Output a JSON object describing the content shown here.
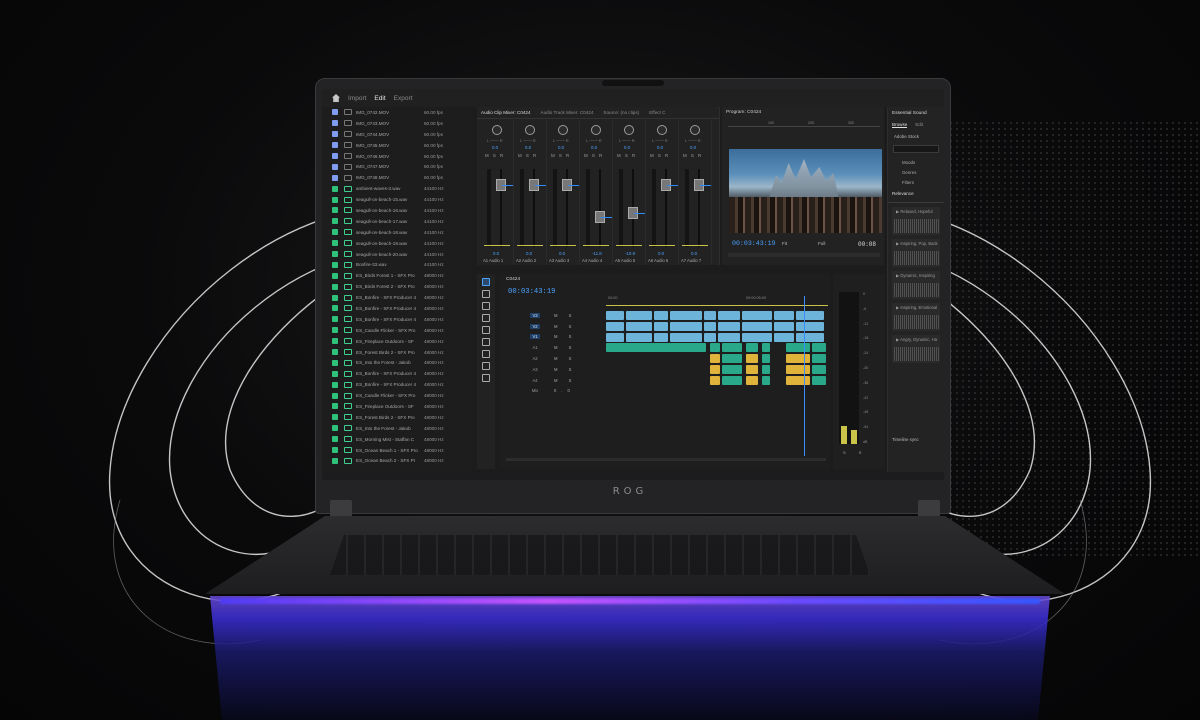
{
  "brand": "ROG",
  "topbar": {
    "items": [
      "Import",
      "Edit",
      "Export"
    ],
    "active": "Edit"
  },
  "project": {
    "rows": [
      {
        "type": "video",
        "name": "IMG_0742.MOV",
        "rate": "60.00 fps"
      },
      {
        "type": "video",
        "name": "IMG_0743.MOV",
        "rate": "60.00 fps"
      },
      {
        "type": "video",
        "name": "IMG_0744.MOV",
        "rate": "60.00 fps"
      },
      {
        "type": "video",
        "name": "IMG_0745.MOV",
        "rate": "60.00 fps"
      },
      {
        "type": "video",
        "name": "IMG_0746.MOV",
        "rate": "60.00 fps"
      },
      {
        "type": "video",
        "name": "IMG_0747.MOV",
        "rate": "60.00 fps"
      },
      {
        "type": "video",
        "name": "IMG_0748.MOV",
        "rate": "60.00 fps"
      },
      {
        "type": "audio",
        "name": "ambient-waves-3.wav",
        "rate": "44100 Hz"
      },
      {
        "type": "audio",
        "name": "seagull-on-beach-15.wav",
        "rate": "44100 Hz"
      },
      {
        "type": "audio",
        "name": "seagull-on-beach-16.wav",
        "rate": "44100 Hz"
      },
      {
        "type": "audio",
        "name": "seagull-on-beach-17.wav",
        "rate": "44100 Hz"
      },
      {
        "type": "audio",
        "name": "seagull-on-beach-18.wav",
        "rate": "44100 Hz"
      },
      {
        "type": "audio",
        "name": "seagull-on-beach-19.wav",
        "rate": "44100 Hz"
      },
      {
        "type": "audio",
        "name": "seagull-on-beach-20.wav",
        "rate": "44100 Hz"
      },
      {
        "type": "audio",
        "name": "Bonfire-33.wav",
        "rate": "44100 Hz"
      },
      {
        "type": "audio",
        "name": "ES_Birds Forest 1 - SFX Pro",
        "rate": "48000 Hz"
      },
      {
        "type": "audio",
        "name": "ES_Birds Forest 2 - SFX Pro",
        "rate": "48000 Hz"
      },
      {
        "type": "audio",
        "name": "ES_Bonfire - SFX Producer 4",
        "rate": "48000 Hz"
      },
      {
        "type": "audio",
        "name": "ES_Bonfire - SFX Producer 4",
        "rate": "48000 Hz"
      },
      {
        "type": "audio",
        "name": "ES_Bonfire - SFX Producer 4",
        "rate": "48000 Hz"
      },
      {
        "type": "audio",
        "name": "ES_Candle Flicker - SFX Pro",
        "rate": "48000 Hz"
      },
      {
        "type": "audio",
        "name": "ES_Fireplace Outdoors - SF",
        "rate": "48000 Hz"
      },
      {
        "type": "audio",
        "name": "ES_Forest Birds 2 - SFX Pro",
        "rate": "48000 Hz"
      },
      {
        "type": "audio",
        "name": "ES_Into the Forest - Jakob",
        "rate": "48000 Hz"
      },
      {
        "type": "audio",
        "name": "ES_Bonfire - SFX Producer 4",
        "rate": "48000 Hz"
      },
      {
        "type": "audio",
        "name": "ES_Bonfire - SFX Producer 4",
        "rate": "48000 Hz"
      },
      {
        "type": "audio",
        "name": "ES_Candle Flicker - SFX Pro",
        "rate": "48000 Hz"
      },
      {
        "type": "audio",
        "name": "ES_Fireplace Outdoors - SF",
        "rate": "48000 Hz"
      },
      {
        "type": "audio",
        "name": "ES_Forest Birds 2 - SFX Pro",
        "rate": "48000 Hz"
      },
      {
        "type": "audio",
        "name": "ES_Into the Forest - Jakob",
        "rate": "48000 Hz"
      },
      {
        "type": "audio",
        "name": "ES_Morning Mist - Staffan C",
        "rate": "48000 Hz"
      },
      {
        "type": "audio",
        "name": "ES_Ocean Beach 1 - SFX Pro",
        "rate": "48000 Hz"
      },
      {
        "type": "audio",
        "name": "ES_Ocean Beach 2 - SFX Pr",
        "rate": "48000 Hz"
      }
    ]
  },
  "mixer": {
    "tabs": [
      "Audio Clip Mixer: C0424",
      "Audio Track Mixer: C0424",
      "Source: (no clips)",
      "Effect C"
    ],
    "channels": [
      {
        "pan": "0.0",
        "db": "0.0",
        "name": "Audio 1",
        "track": "A1"
      },
      {
        "pan": "0.0",
        "db": "0.0",
        "name": "Audio 2",
        "track": "A2"
      },
      {
        "pan": "0.0",
        "db": "0.0",
        "name": "Audio 3",
        "track": "A3"
      },
      {
        "pan": "0.0",
        "db": "-11.8",
        "name": "Audio 4",
        "track": "A4"
      },
      {
        "pan": "0.0",
        "db": "-10.9",
        "name": "Audio 5",
        "track": "A5"
      },
      {
        "pan": "0.0",
        "db": "0.0",
        "name": "Audio 6",
        "track": "A6"
      },
      {
        "pan": "0.0",
        "db": "0.0",
        "name": "Audio 7",
        "track": "A7"
      }
    ]
  },
  "program": {
    "title": "Program: C0424",
    "ruler": [
      "",
      "100",
      "200",
      "300"
    ],
    "timecode": "00:03:43:19",
    "fit": "Fit",
    "full": "Full",
    "duration": "00:08"
  },
  "essential": {
    "title": "Essential Sound",
    "tabs": [
      "Browse",
      "Edit"
    ],
    "source": "Adobe Stock",
    "filters": [
      "Moods",
      "Genres",
      "Filters"
    ],
    "sort": "Relevance",
    "items": [
      "Relaxed, Hopeful",
      "Inspiring, Pop, Back",
      "Dynamic, Inspiring",
      "Inspiring, Emotional",
      "Angry, Dynamic, Ha"
    ],
    "timeline_sync": "Timeline sync"
  },
  "timeline": {
    "title": "C0424",
    "timecode": "00:03:43:19",
    "ruler": [
      "00:00",
      "00:00:05:00"
    ],
    "tracks": [
      {
        "label": "V3",
        "kind": "v"
      },
      {
        "label": "V2",
        "kind": "v"
      },
      {
        "label": "V1",
        "kind": "v"
      },
      {
        "label": "A1",
        "kind": "a"
      },
      {
        "label": "A2",
        "kind": "a"
      },
      {
        "label": "A3",
        "kind": "a"
      },
      {
        "label": "A4",
        "kind": "a"
      }
    ],
    "mix_label": "Mix",
    "mix_value": "0.0"
  },
  "loudness": {
    "scale": [
      "0",
      "-6",
      "-12",
      "-18",
      "-24",
      "-30",
      "-36",
      "-42",
      "-48",
      "-54",
      "dB"
    ],
    "solo": "S S"
  }
}
